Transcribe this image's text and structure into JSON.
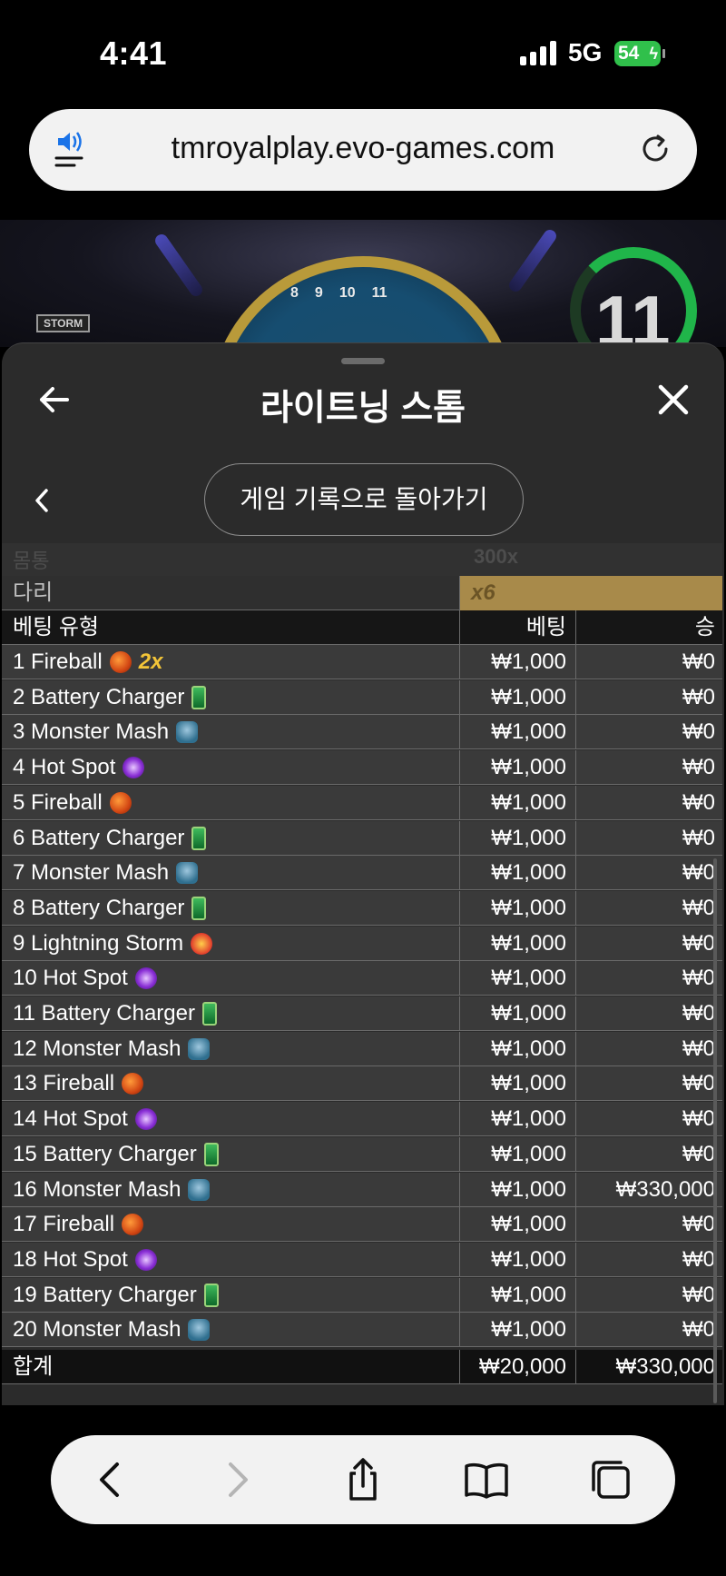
{
  "status_bar": {
    "time": "4:41",
    "network": "5G",
    "battery": "54"
  },
  "browser": {
    "url": "tmroyalplay.evo-games.com"
  },
  "game_banner": {
    "storm_sign": "STORM",
    "timer": "11",
    "wheel_numbers": [
      "8",
      "9",
      "10",
      "11"
    ]
  },
  "sheet": {
    "title": "라이트닝 스톰",
    "back_to_history": "게임 기록으로 돌아가기"
  },
  "table": {
    "faded_row": {
      "label": "몸통",
      "value": "300x"
    },
    "bridge_row": {
      "label": "다리",
      "value": "x6"
    },
    "headers": {
      "type": "베팅 유형",
      "bet": "베팅",
      "win": "승"
    },
    "rows": [
      {
        "type": "1 Fireball",
        "icon": "fireball-icon",
        "multiplier": "2x",
        "bet": "₩1,000",
        "win": "₩0"
      },
      {
        "type": "2 Battery Charger",
        "icon": "battery-icon",
        "bet": "₩1,000",
        "win": "₩0"
      },
      {
        "type": "3 Monster Mash",
        "icon": "monster-icon",
        "bet": "₩1,000",
        "win": "₩0"
      },
      {
        "type": "4 Hot Spot",
        "icon": "hotspot-icon",
        "bet": "₩1,000",
        "win": "₩0"
      },
      {
        "type": "5 Fireball",
        "icon": "fireball-icon",
        "bet": "₩1,000",
        "win": "₩0"
      },
      {
        "type": "6 Battery Charger",
        "icon": "battery-icon",
        "bet": "₩1,000",
        "win": "₩0"
      },
      {
        "type": "7 Monster Mash",
        "icon": "monster-icon",
        "bet": "₩1,000",
        "win": "₩0"
      },
      {
        "type": "8 Battery Charger",
        "icon": "battery-icon",
        "bet": "₩1,000",
        "win": "₩0"
      },
      {
        "type": "9 Lightning Storm",
        "icon": "lightning-icon",
        "bet": "₩1,000",
        "win": "₩0"
      },
      {
        "type": "10 Hot Spot",
        "icon": "hotspot-icon",
        "bet": "₩1,000",
        "win": "₩0"
      },
      {
        "type": "11 Battery Charger",
        "icon": "battery-icon",
        "bet": "₩1,000",
        "win": "₩0"
      },
      {
        "type": "12 Monster Mash",
        "icon": "monster-icon",
        "bet": "₩1,000",
        "win": "₩0"
      },
      {
        "type": "13 Fireball",
        "icon": "fireball-icon",
        "bet": "₩1,000",
        "win": "₩0"
      },
      {
        "type": "14 Hot Spot",
        "icon": "hotspot-icon",
        "bet": "₩1,000",
        "win": "₩0"
      },
      {
        "type": "15 Battery Charger",
        "icon": "battery-icon",
        "bet": "₩1,000",
        "win": "₩0"
      },
      {
        "type": "16 Monster Mash",
        "icon": "monster-icon",
        "bet": "₩1,000",
        "win": "₩330,000"
      },
      {
        "type": "17 Fireball",
        "icon": "fireball-icon",
        "bet": "₩1,000",
        "win": "₩0"
      },
      {
        "type": "18 Hot Spot",
        "icon": "hotspot-icon",
        "bet": "₩1,000",
        "win": "₩0"
      },
      {
        "type": "19 Battery Charger",
        "icon": "battery-icon",
        "bet": "₩1,000",
        "win": "₩0"
      },
      {
        "type": "20 Monster Mash",
        "icon": "monster-icon",
        "bet": "₩1,000",
        "win": "₩0"
      }
    ],
    "total": {
      "label": "합계",
      "bet": "₩20,000",
      "win": "₩330,000"
    }
  },
  "toolbar": {
    "icons": [
      "back-icon",
      "forward-icon",
      "share-icon",
      "bookmarks-icon",
      "tabs-icon"
    ]
  }
}
